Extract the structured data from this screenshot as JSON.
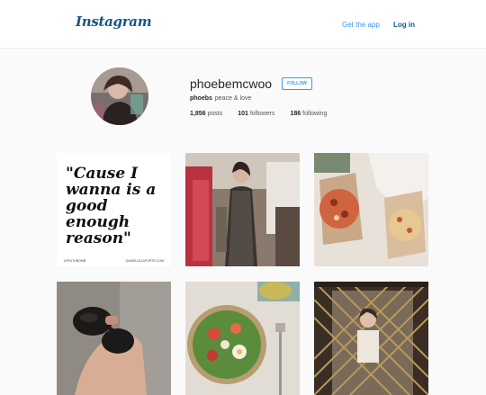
{
  "header": {
    "logo": "Instagram",
    "get_app": "Get the app",
    "login": "Log in"
  },
  "profile": {
    "username": "phoebemcwoo",
    "follow_label": "FOLLOW",
    "full_name": "phoebs",
    "bio": "peace & love",
    "posts_count": "1,856",
    "posts_label": "posts",
    "followers_count": "101",
    "followers_label": "followers",
    "following_count": "186",
    "following_label": "following"
  },
  "posts": [
    {
      "quote": "\"Cause I wanna is a good enough reason\"",
      "tag_left": "#TRUTHBOMB",
      "tag_right": "DANIELLELAPORTE.COM"
    },
    {},
    {},
    {},
    {},
    {}
  ],
  "colors": {
    "link_blue": "#3897f0",
    "brand_blue": "#125688"
  }
}
